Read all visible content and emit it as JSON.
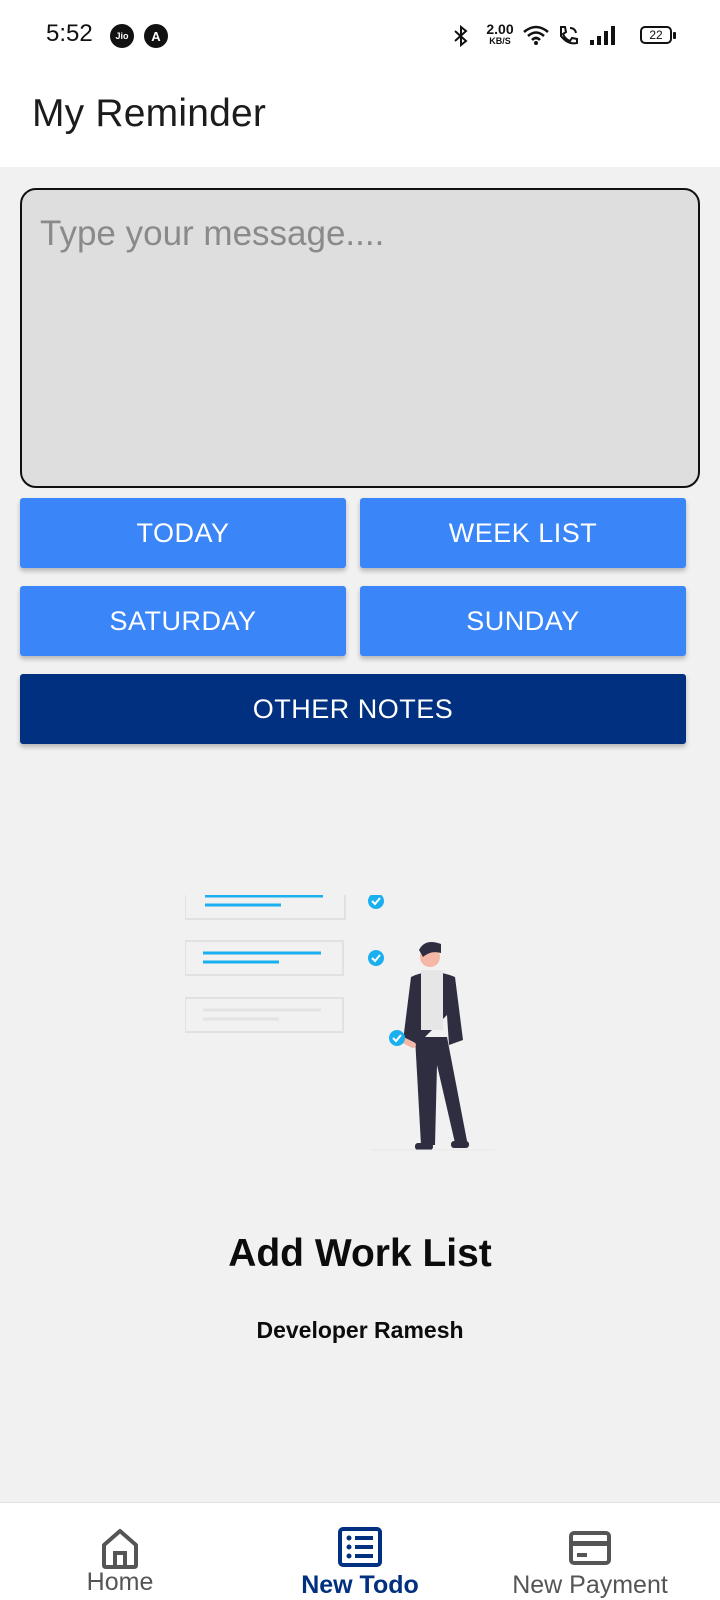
{
  "status_bar": {
    "time": "5:52",
    "app_icon_1": "Jio",
    "app_icon_2": "A",
    "net_speed": "2.00",
    "net_speed_unit": "KB/S",
    "battery": "22"
  },
  "app_bar": {
    "title": "My Reminder"
  },
  "message": {
    "placeholder": "Type your message....",
    "value": ""
  },
  "buttons": {
    "today": "TODAY",
    "week_list": "WEEK LIST",
    "saturday": "SATURDAY",
    "sunday": "SUNDAY",
    "other_notes": "OTHER NOTES"
  },
  "empty_state": {
    "title": "Add Work List",
    "subtitle": "Developer Ramesh"
  },
  "bottom_nav": {
    "items": [
      {
        "label": "Home",
        "icon": "home-icon",
        "active": false
      },
      {
        "label": "New Todo",
        "icon": "list-icon",
        "active": true
      },
      {
        "label": "New Payment",
        "icon": "card-icon",
        "active": false
      }
    ]
  },
  "colors": {
    "primary_button": "#3a86f9",
    "dark_button": "#00307f",
    "background": "#f1f1f1",
    "accent_check": "#1ab0f0"
  }
}
